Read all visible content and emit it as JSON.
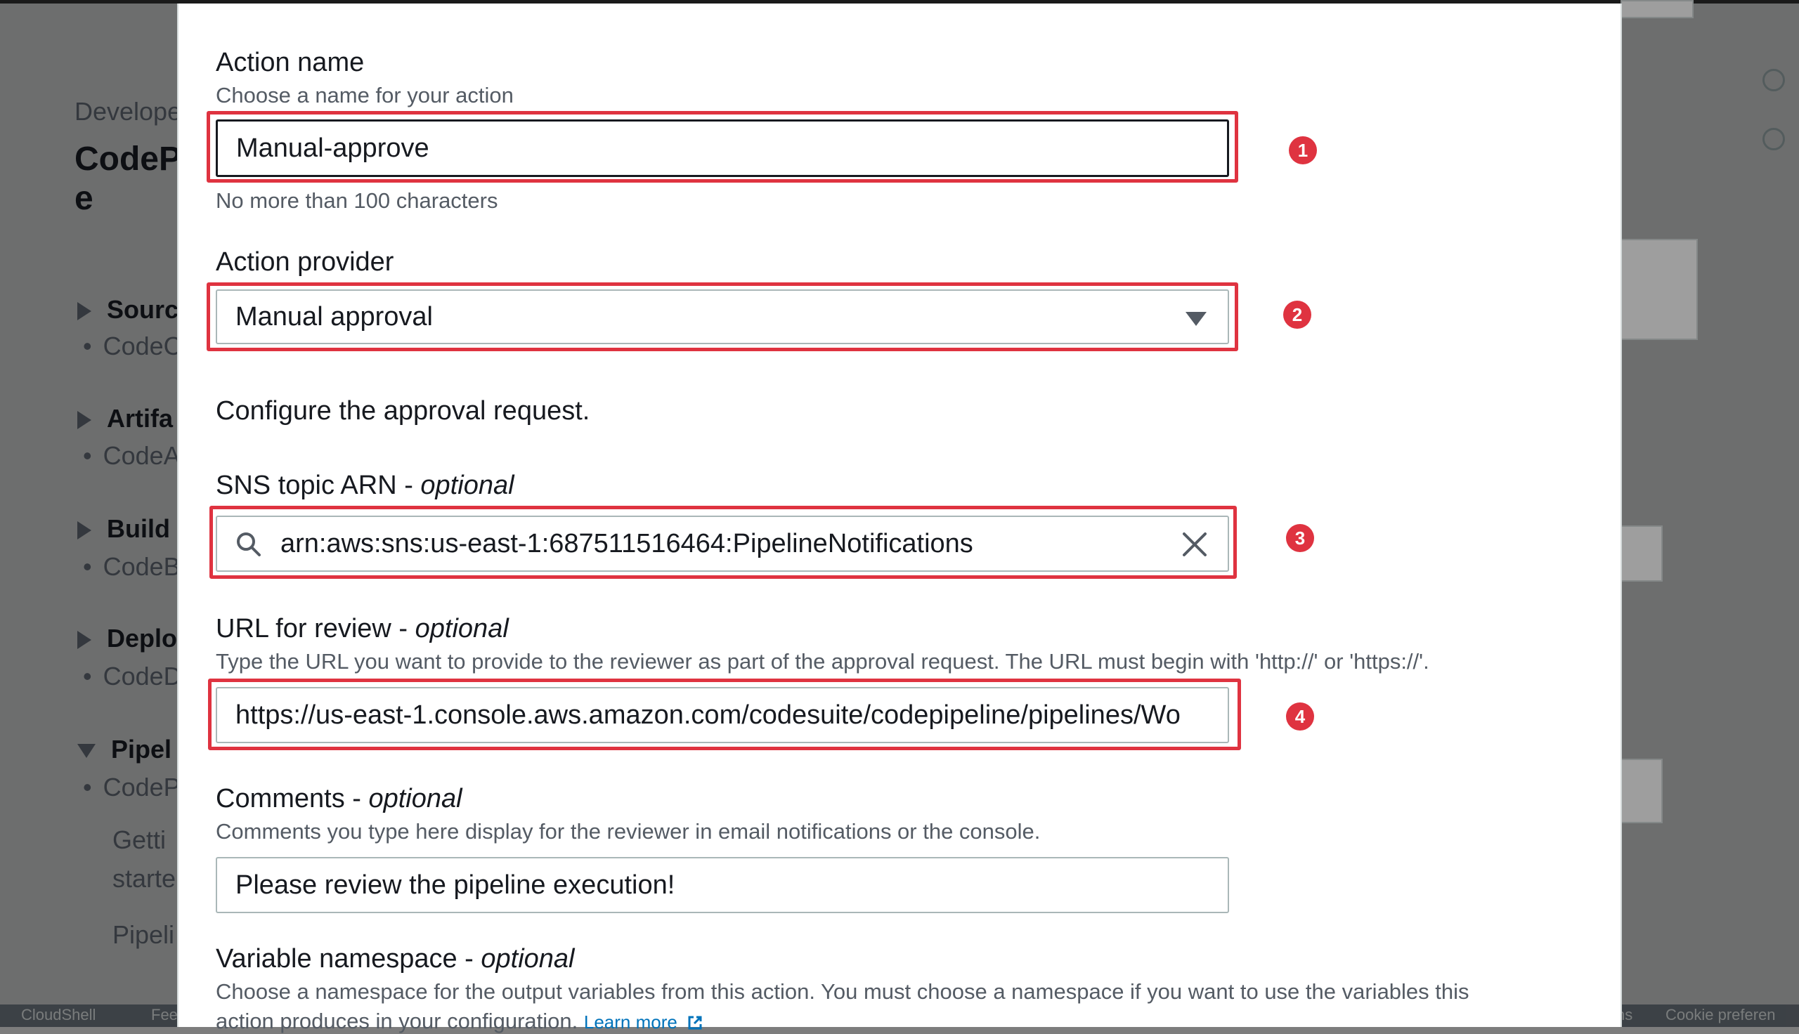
{
  "background": {
    "breadcrumb": "Develope",
    "title_line1": "CodeP",
    "title_line2": "e",
    "nav": [
      {
        "label": "Sourc",
        "sub": "CodeC"
      },
      {
        "label": "Artifa",
        "sub": "CodeA"
      },
      {
        "label": "Build",
        "sub": "CodeB"
      },
      {
        "label": "Deplo",
        "sub": "CodeD"
      },
      {
        "label": "Pipel",
        "sub": "CodeP"
      }
    ],
    "getting_started_1": "Getti",
    "getting_started_2": "starte",
    "pipelines": "Pipeli",
    "footer": {
      "cloudshell": "CloudShell",
      "feedback": "Fee",
      "right_text_1": "ns",
      "right_text_2": "Cookie preferen"
    }
  },
  "form": {
    "action_name": {
      "label": "Action name",
      "description": "Choose a name for your action",
      "value": "Manual-approve",
      "hint": "No more than 100 characters",
      "badge": "1"
    },
    "action_provider": {
      "label": "Action provider",
      "value": "Manual approval",
      "badge": "2"
    },
    "section_heading": "Configure the approval request.",
    "sns_topic": {
      "label": "SNS topic ARN - ",
      "optional": "optional",
      "value": "arn:aws:sns:us-east-1:687511516464:PipelineNotifications",
      "badge": "3"
    },
    "url_review": {
      "label": "URL for review - ",
      "optional": "optional",
      "description": "Type the URL you want to provide to the reviewer as part of the approval request. The URL must begin with 'http://' or 'https://'.",
      "value": "https://us-east-1.console.aws.amazon.com/codesuite/codepipeline/pipelines/Wo",
      "badge": "4"
    },
    "comments": {
      "label": "Comments - ",
      "optional": "optional",
      "description": "Comments you type here display for the reviewer in email notifications or the console.",
      "value": "Please review the pipeline execution!"
    },
    "variable_namespace": {
      "label": "Variable namespace - ",
      "optional": "optional",
      "description_line1": "Choose a namespace for the output variables from this action. You must choose a namespace if you want to use the variables this",
      "description_line2": "action produces in your configuration.",
      "learn_more": "Learn more"
    }
  },
  "colors": {
    "highlight": "#df3340",
    "text": "#16191f",
    "muted": "#545b64",
    "link": "#0073bb"
  },
  "icons": [
    "search-icon",
    "clear-icon",
    "caret-down-icon",
    "external-link-icon",
    "info-icon",
    "settings-icon"
  ]
}
